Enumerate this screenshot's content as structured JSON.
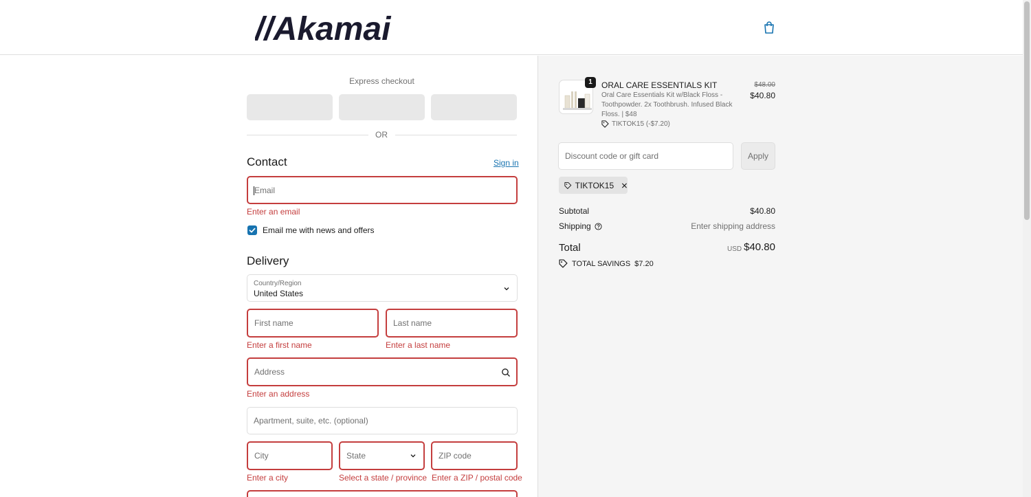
{
  "brand": {
    "name": "//Akamai"
  },
  "express": {
    "label": "Express checkout",
    "or": "OR"
  },
  "contact": {
    "title": "Contact",
    "sign_in": "Sign in",
    "email_placeholder": "Email",
    "email_error": "Enter an email",
    "newsletter_label": "Email me with news and offers",
    "newsletter_checked": true
  },
  "delivery": {
    "title": "Delivery",
    "country_label": "Country/Region",
    "country_value": "United States",
    "first_name_placeholder": "First name",
    "first_name_error": "Enter a first name",
    "last_name_placeholder": "Last name",
    "last_name_error": "Enter a last name",
    "address_placeholder": "Address",
    "address_error": "Enter an address",
    "apartment_placeholder": "Apartment, suite, etc. (optional)",
    "city_placeholder": "City",
    "city_error": "Enter a city",
    "state_placeholder": "State",
    "state_error": "Select a state / province",
    "zip_placeholder": "ZIP code",
    "zip_error": "Enter a ZIP / postal code"
  },
  "summary": {
    "item": {
      "quantity": "1",
      "title": "ORAL CARE ESSENTIALS KIT",
      "description": "Oral Care Essentials Kit w/Black Floss - Toothpowder. 2x Toothbrush. Infused Black Floss. | $48",
      "discount": "TIKTOK15 (-$7.20)",
      "original_price": "$48.00",
      "price": "$40.80"
    },
    "discount_placeholder": "Discount code or gift card",
    "apply_label": "Apply",
    "applied_code": "TIKTOK15",
    "subtotal_label": "Subtotal",
    "subtotal_value": "$40.80",
    "shipping_label": "Shipping",
    "shipping_value": "Enter shipping address",
    "total_label": "Total",
    "total_currency": "USD",
    "total_value": "$40.80",
    "savings_label": "TOTAL SAVINGS",
    "savings_value": "$7.20"
  },
  "colors": {
    "accent": "#1773b0",
    "error": "#c43d3d",
    "summary_bg": "#f5f5f5"
  },
  "icons": [
    "shopping-bag-icon",
    "checkmark-icon",
    "chevron-down-icon",
    "search-icon",
    "tag-icon",
    "close-icon",
    "question-circle-icon"
  ]
}
